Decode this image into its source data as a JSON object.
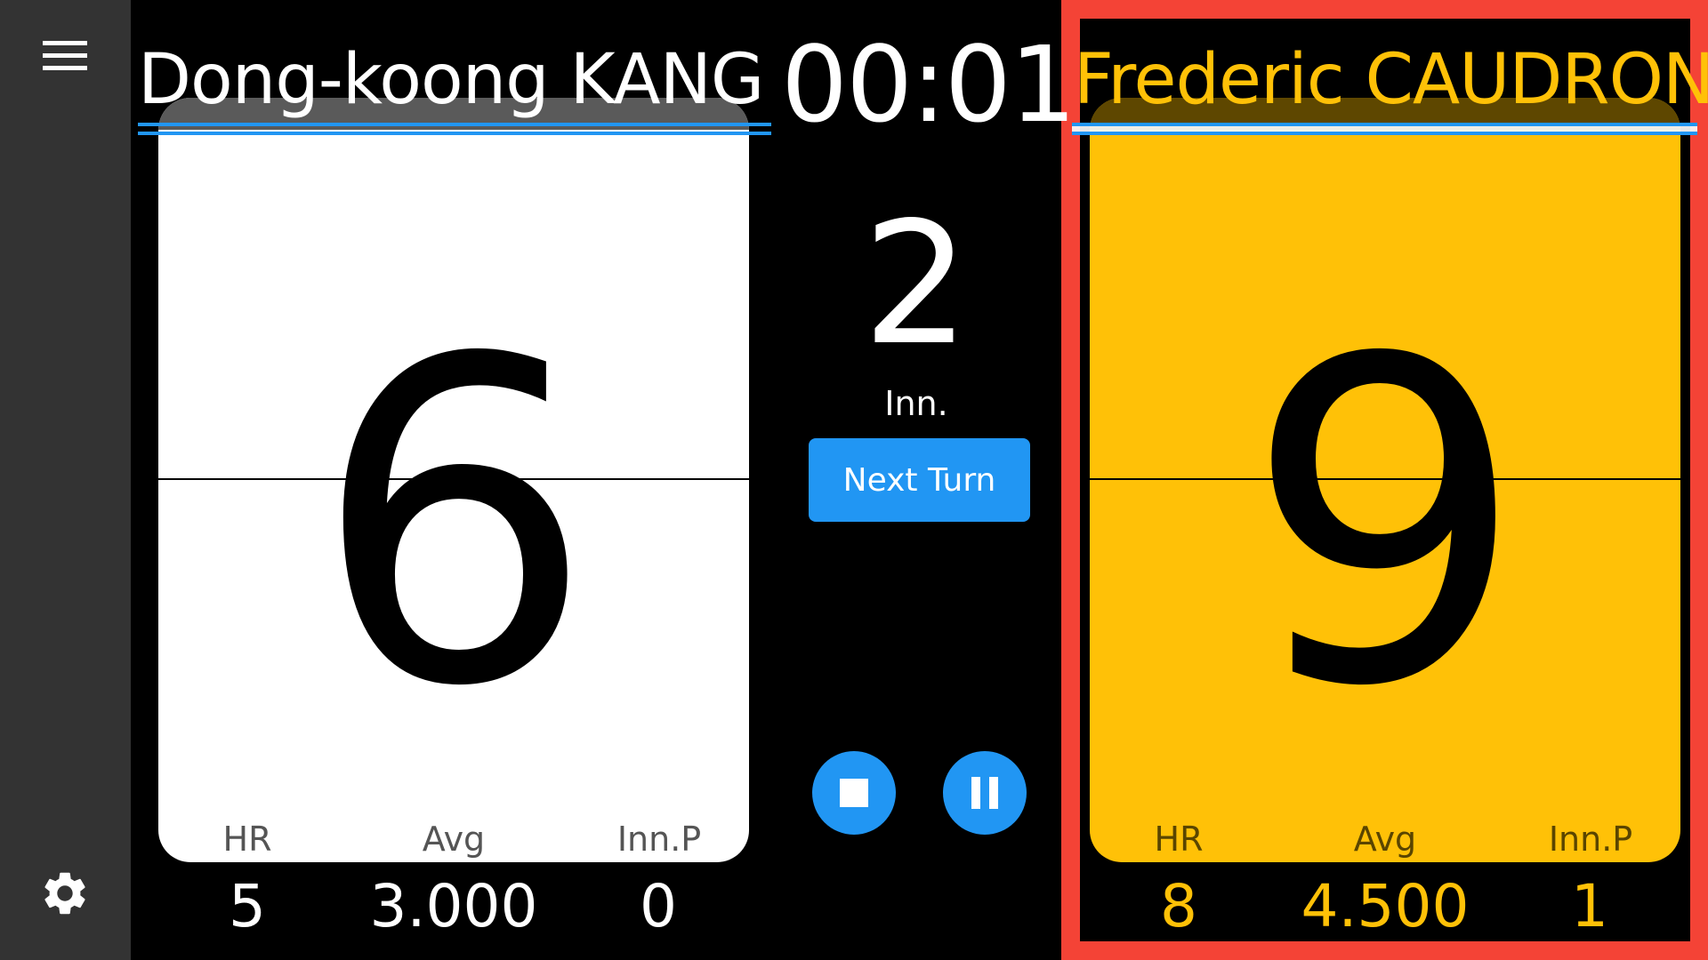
{
  "sidebar": {
    "menu_icon": "hamburger-menu-icon",
    "settings_icon": "gear-icon"
  },
  "timer": "00:01",
  "innings": {
    "value": "2",
    "label": "Inn."
  },
  "controls": {
    "next_turn_label": "Next Turn",
    "stop_icon": "stop-icon",
    "pause_icon": "pause-icon"
  },
  "players": [
    {
      "name": "Dong-koong KANG",
      "score": "6",
      "stats": {
        "hr_label": "HR",
        "avg_label": "Avg",
        "innp_label": "Inn.P",
        "hr": "5",
        "avg": "3.000",
        "innp": "0"
      },
      "color": "#FFFFFF",
      "active": false
    },
    {
      "name": "Frederic CAUDRON",
      "score": "9",
      "stats": {
        "hr_label": "HR",
        "avg_label": "Avg",
        "innp_label": "Inn.P",
        "hr": "8",
        "avg": "4.500",
        "innp": "1"
      },
      "color": "#FFC107",
      "active": true
    }
  ],
  "colors": {
    "accent": "#2196F3",
    "active_frame": "#F44336",
    "player2": "#FFC107",
    "sidebar": "#333333"
  }
}
